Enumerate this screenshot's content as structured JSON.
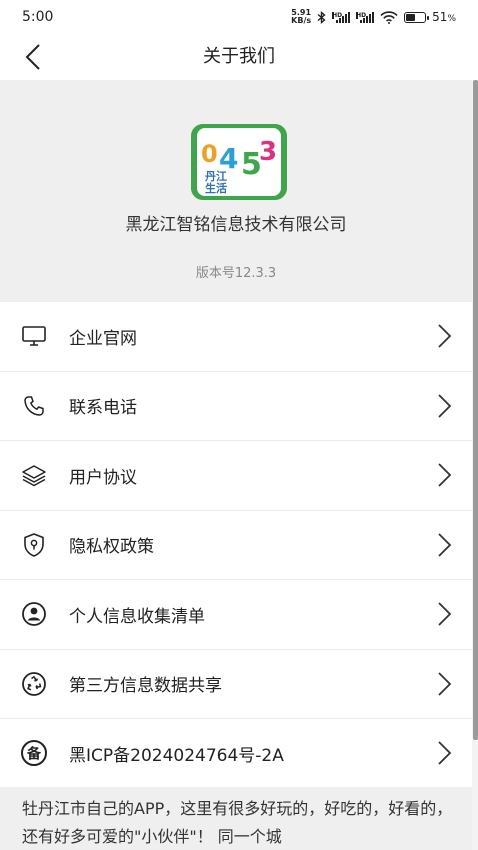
{
  "status_bar": {
    "time": "5:00",
    "net_speed_value": "5.91",
    "net_speed_unit": "KB/s",
    "hd_label_1": "HD",
    "hd_label_2": "HD",
    "battery_percent": "51",
    "battery_suffix": "%",
    "battery_level": 0.51
  },
  "nav": {
    "title": "关于我们"
  },
  "header": {
    "logo_numbers": "0453",
    "logo_text_line1": "丹江",
    "logo_text_line2": "生活",
    "company_name": "黑龙江智铭信息技术有限公司",
    "version": "版本号12.3.3"
  },
  "menu": {
    "items": [
      {
        "label": "企业官网",
        "icon": "monitor-icon"
      },
      {
        "label": "联系电话",
        "icon": "phone-icon"
      },
      {
        "label": "用户协议",
        "icon": "layers-icon"
      },
      {
        "label": "隐私权政策",
        "icon": "shield-lock-icon"
      },
      {
        "label": "个人信息收集清单",
        "icon": "user-circle-icon"
      },
      {
        "label": "第三方信息数据共享",
        "icon": "recycle-icon"
      },
      {
        "label": "黑ICP备2024024764号-2A",
        "icon": "bei-icon"
      }
    ],
    "bei_glyph": "备"
  },
  "description": {
    "text": "牡丹江市自己的APP，这里有很多好玩的，好吃的，好看的，还有好多可爱的\"小伙伴\"！ 同一个城"
  },
  "colors": {
    "logo_green": "#3ea64a",
    "header_bg": "#efefef",
    "divider": "#ebebeb"
  }
}
